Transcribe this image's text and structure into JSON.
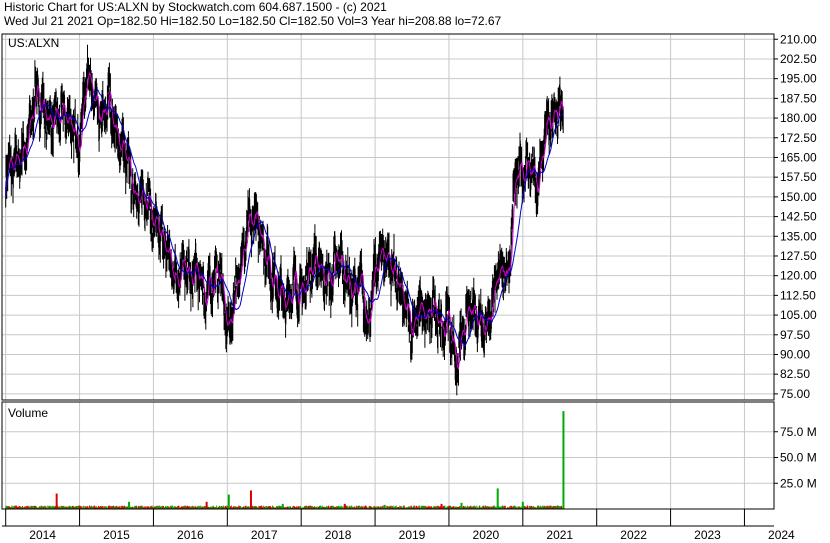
{
  "header": {
    "line1": "Historic Chart for US:ALXN by Stockwatch.com 604.687.1500 - (c) 2021",
    "line2": "Wed Jul 21 2021   Op=182.50  Hi=182.50  Lo=182.50  Cl=182.50  Vol=3   Year hi=208.88  lo=72.67"
  },
  "colors": {
    "price": "#000000",
    "ma_short": "#cc00cc",
    "ma_long": "#0000cc",
    "vol_up": "#00aa00",
    "vol_down": "#dd0000",
    "grid": "#c8c8c8"
  },
  "chart_data": [
    {
      "type": "line",
      "panel": "price",
      "label": "US:ALXN",
      "ylim": [
        72.67,
        212
      ],
      "y_ticks": [
        "210.00",
        "202.50",
        "195.00",
        "187.50",
        "180.00",
        "172.50",
        "165.00",
        "157.50",
        "150.00",
        "142.50",
        "135.00",
        "127.50",
        "120.00",
        "112.50",
        "105.00",
        "97.50",
        "90.00",
        "82.50",
        "75.00"
      ],
      "y_tick_values": [
        210,
        202.5,
        195,
        187.5,
        180,
        172.5,
        165,
        157.5,
        150,
        142.5,
        135,
        127.5,
        120,
        112.5,
        105,
        97.5,
        90,
        82.5,
        75
      ],
      "x_ticks": [
        "2014",
        "2015",
        "2016",
        "2017",
        "2018",
        "2019",
        "2020",
        "2021",
        "2022",
        "2023",
        "2024"
      ],
      "x_tick_values": [
        2014,
        2015,
        2016,
        2017,
        2018,
        2019,
        2020,
        2021,
        2022,
        2023,
        2024
      ],
      "xlim": [
        2013.95,
        2024.4
      ],
      "grid": true,
      "series": [
        {
          "x": [
            2014.0,
            2014.1,
            2014.2,
            2014.3,
            2014.4,
            2014.5,
            2014.6,
            2014.7,
            2014.8,
            2014.9,
            2015.0,
            2015.1,
            2015.2,
            2015.3,
            2015.4,
            2015.5,
            2015.6,
            2015.7,
            2015.8,
            2015.9,
            2016.0,
            2016.1,
            2016.2,
            2016.3,
            2016.4,
            2016.5,
            2016.6,
            2016.7,
            2016.8,
            2016.9,
            2017.0,
            2017.1,
            2017.2,
            2017.3,
            2017.4,
            2017.5,
            2017.6,
            2017.7,
            2017.8,
            2017.9,
            2018.0,
            2018.1,
            2018.2,
            2018.3,
            2018.4,
            2018.5,
            2018.6,
            2018.7,
            2018.8,
            2018.9,
            2019.0,
            2019.1,
            2019.2,
            2019.3,
            2019.4,
            2019.5,
            2019.6,
            2019.7,
            2019.8,
            2019.9,
            2020.0,
            2020.1,
            2020.2,
            2020.3,
            2020.4,
            2020.5,
            2020.6,
            2020.7,
            2020.8,
            2020.9,
            2021.0,
            2021.1,
            2021.2,
            2021.3,
            2021.4,
            2021.55
          ],
          "values": [
            160,
            162,
            165,
            172,
            190,
            184,
            178,
            180,
            182,
            176,
            170,
            200,
            185,
            178,
            188,
            172,
            168,
            156,
            148,
            152,
            140,
            135,
            128,
            118,
            125,
            118,
            122,
            112,
            118,
            122,
            98,
            112,
            128,
            140,
            142,
            130,
            120,
            115,
            108,
            118,
            112,
            122,
            126,
            120,
            118,
            128,
            120,
            113,
            118,
            100,
            122,
            130,
            125,
            118,
            108,
            100,
            108,
            103,
            110,
            98,
            105,
            85,
            100,
            108,
            105,
            100,
            112,
            124,
            120,
            158,
            160,
            162,
            152,
            175,
            180,
            182.5
          ]
        }
      ]
    },
    {
      "type": "bar",
      "panel": "volume",
      "label": "Volume",
      "ylim": [
        0,
        100
      ],
      "y_ticks": [
        "75.0 M",
        "50.0 M",
        "25.0 M"
      ],
      "y_tick_values": [
        75,
        50,
        25
      ],
      "series": [
        {
          "x": [
            2014.69,
            2015.67,
            2016.72,
            2017.02,
            2017.32,
            2017.75,
            2018.59,
            2019.13,
            2019.9,
            2020.17,
            2020.66,
            2021.0,
            2021.55
          ],
          "values": [
            15,
            7,
            7,
            14,
            18,
            5,
            5,
            4,
            5,
            6,
            20,
            7,
            95
          ]
        }
      ]
    }
  ]
}
